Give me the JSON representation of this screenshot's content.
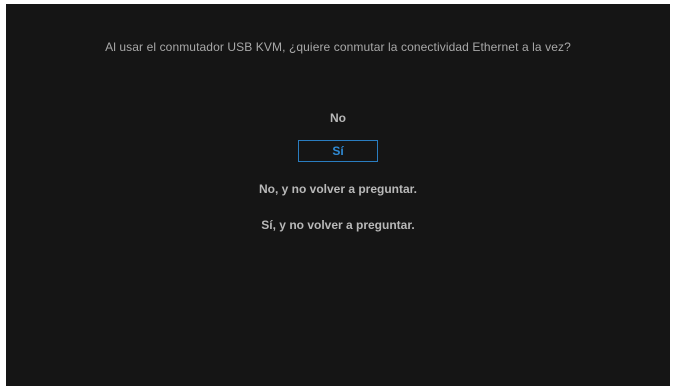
{
  "dialog": {
    "question": "Al usar el conmutador USB KVM, ¿quiere conmutar la conectividad Ethernet a la vez?",
    "options": [
      {
        "label": "No",
        "selected": false
      },
      {
        "label": "Sí",
        "selected": true
      },
      {
        "label": "No, y no volver a preguntar.",
        "selected": false
      },
      {
        "label": "Sí, y no volver a preguntar.",
        "selected": false
      }
    ]
  },
  "colors": {
    "background": "#151515",
    "text": "#b8b8b8",
    "highlight": "#2f8bd6"
  }
}
